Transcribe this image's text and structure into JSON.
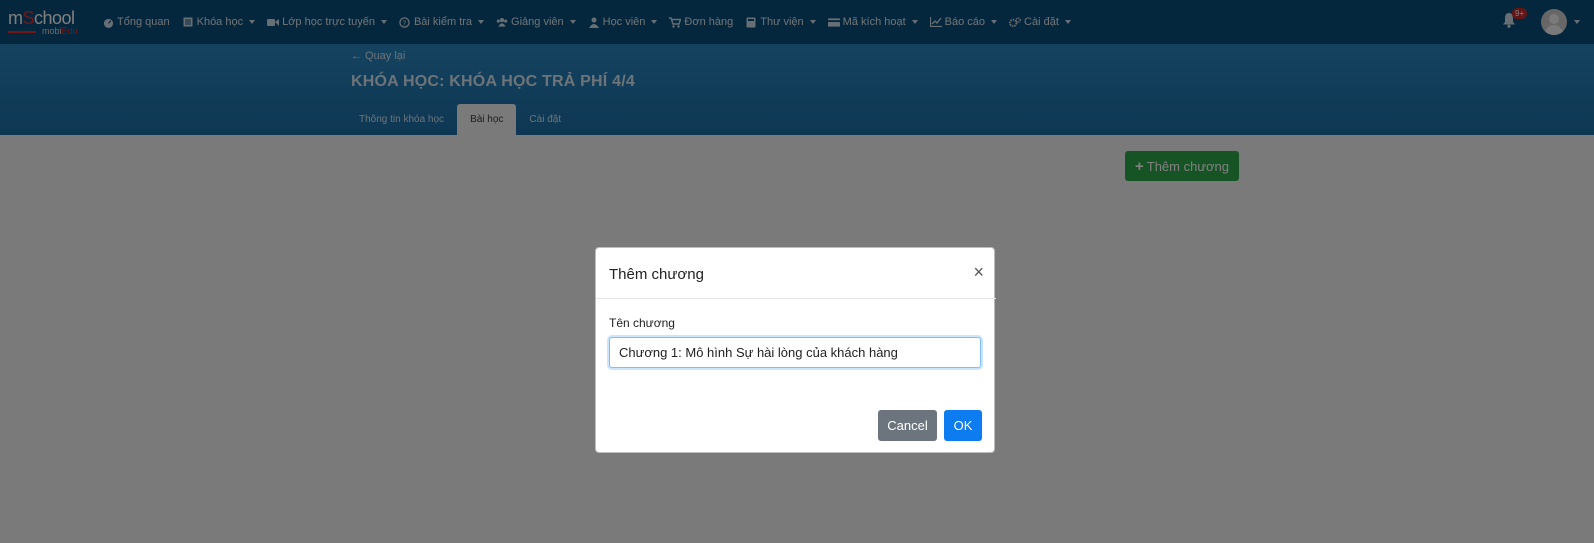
{
  "navbar": {
    "logo_brand_m": "m",
    "logo_brand_s": "S",
    "logo_brand_rest": "chool",
    "logo_sub_mobi": "mobi",
    "logo_sub_edu": "Edu",
    "items": [
      {
        "label": "Tổng quan",
        "icon": "dashboard-icon",
        "dropdown": false
      },
      {
        "label": "Khóa học",
        "icon": "book-list-icon",
        "dropdown": true
      },
      {
        "label": "Lớp học trực tuyến",
        "icon": "video-camera-icon",
        "dropdown": true
      },
      {
        "label": "Bài kiểm tra",
        "icon": "question-circle-icon",
        "dropdown": true
      },
      {
        "label": "Giảng viên",
        "icon": "users-icon",
        "dropdown": true
      },
      {
        "label": "Học viên",
        "icon": "user-icon",
        "dropdown": true
      },
      {
        "label": "Đơn hàng",
        "icon": "cart-icon",
        "dropdown": false
      },
      {
        "label": "Thư viện",
        "icon": "library-book-icon",
        "dropdown": true
      },
      {
        "label": "Mã kích hoạt",
        "icon": "credit-card-icon",
        "dropdown": true
      },
      {
        "label": "Báo cáo",
        "icon": "line-chart-icon",
        "dropdown": true
      },
      {
        "label": "Cài đặt",
        "icon": "gears-icon",
        "dropdown": true
      }
    ],
    "notification_badge": "9+"
  },
  "header": {
    "back_label": "Quay lại",
    "title": "KHÓA HỌC: KHÓA HỌC TRẢ PHÍ 4/4",
    "tabs": [
      {
        "label": "Thông tin khóa học",
        "active": false
      },
      {
        "label": "Bài học",
        "active": true
      },
      {
        "label": "Cài đặt",
        "active": false
      }
    ]
  },
  "toolbar": {
    "add_chapter_label": "Thêm chương"
  },
  "modal": {
    "title": "Thêm chương",
    "field_label": "Tên chương",
    "field_value": "Chương 1: Mô hình Sự hài lòng của khách hàng",
    "cancel_label": "Cancel",
    "ok_label": "OK"
  },
  "colors": {
    "navbar_bg": "#0b4f7a",
    "header_bg": "#2a86c0",
    "add_button": "#2fa84a",
    "ok_button": "#0d7cf0",
    "cancel_button": "#6c757d",
    "brand_accent": "#e52d2d"
  }
}
